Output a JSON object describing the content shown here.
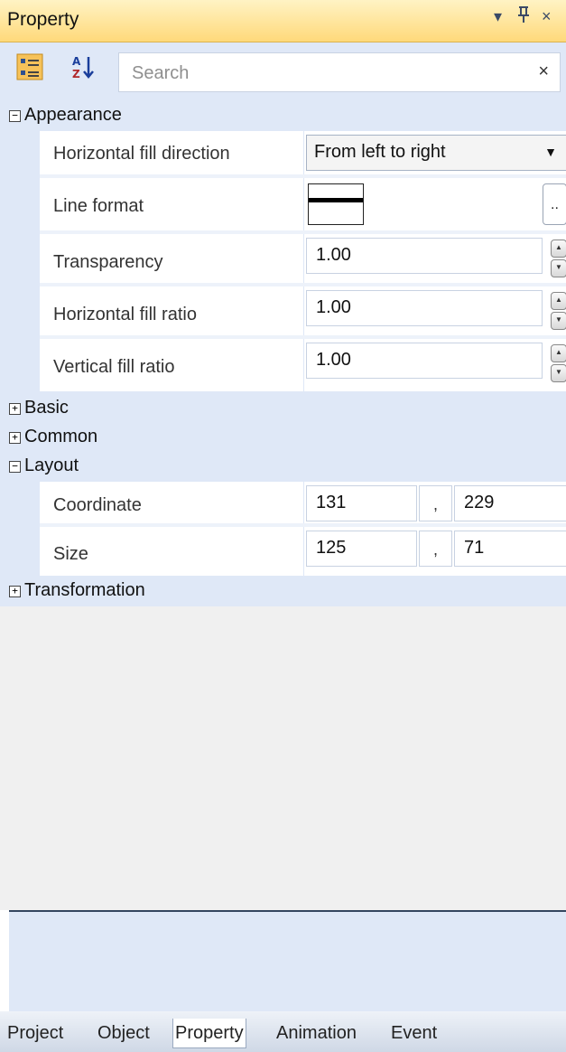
{
  "panel": {
    "title": "Property",
    "controls": {
      "dropdown": "▾",
      "pin": "ꟸ",
      "close": "×"
    }
  },
  "toolbar": {
    "categorized_icon": "categorized-icon",
    "alphabetical_icon": "sort-alphabetical-icon",
    "search_placeholder": "Search",
    "clear": "×"
  },
  "categories": {
    "appearance": {
      "toggle": "−",
      "label": "Appearance",
      "properties": {
        "horizontal_fill_direction": {
          "name": "Horizontal fill direction",
          "value": "From left to right"
        },
        "line_format": {
          "name": "Line format",
          "button": ".."
        },
        "transparency": {
          "name": "Transparency",
          "value": "1.00"
        },
        "horizontal_fill_ratio": {
          "name": "Horizontal fill ratio",
          "value": "1.00"
        },
        "vertical_fill_ratio": {
          "name": "Vertical fill ratio",
          "value": "1.00"
        }
      }
    },
    "basic": {
      "toggle": "+",
      "label": "Basic"
    },
    "common": {
      "toggle": "+",
      "label": "Common"
    },
    "layout": {
      "toggle": "−",
      "label": "Layout",
      "properties": {
        "coordinate": {
          "name": "Coordinate",
          "x": "131",
          "sep": ",",
          "y": "229"
        },
        "size": {
          "name": "Size",
          "w": "125",
          "sep": ",",
          "h": "71"
        }
      }
    },
    "transformation": {
      "toggle": "+",
      "label": "Transformation"
    }
  },
  "tabs": [
    {
      "label": "Project",
      "active": false
    },
    {
      "label": "Object",
      "active": false
    },
    {
      "label": "Property",
      "active": true
    },
    {
      "label": "Animation",
      "active": false
    },
    {
      "label": "Event",
      "active": false
    }
  ],
  "colors": {
    "titlebar": "#ffd97a",
    "grid_background": "#dfe8f7",
    "description_divider": "#34465f"
  }
}
